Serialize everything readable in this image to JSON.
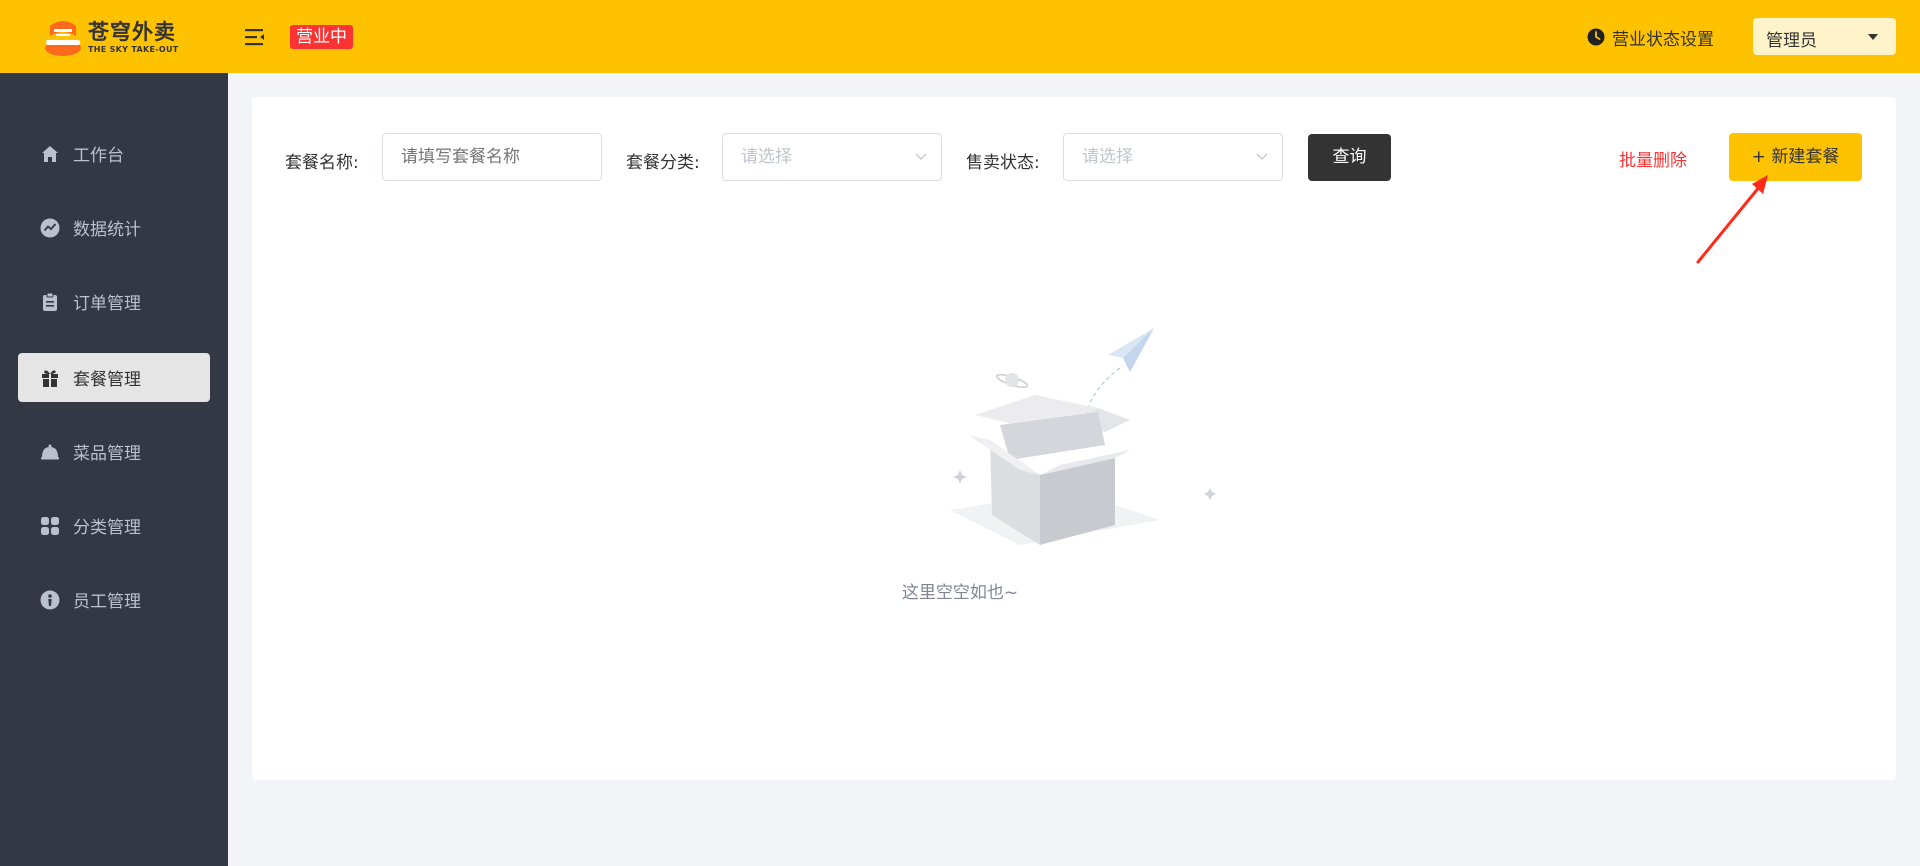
{
  "header": {
    "logo_cn": "苍穹外卖",
    "logo_en": "THE SKY TAKE-OUT",
    "status_tag": "营业中",
    "shop_setting": "营业状态设置",
    "user": "管理员"
  },
  "sidebar": {
    "items": [
      {
        "label": "工作台",
        "icon": "home-icon"
      },
      {
        "label": "数据统计",
        "icon": "chart-icon"
      },
      {
        "label": "订单管理",
        "icon": "clipboard-icon"
      },
      {
        "label": "套餐管理",
        "icon": "gift-icon",
        "active": true
      },
      {
        "label": "菜品管理",
        "icon": "dish-icon"
      },
      {
        "label": "分类管理",
        "icon": "grid-icon"
      },
      {
        "label": "员工管理",
        "icon": "employee-icon"
      }
    ]
  },
  "filters": {
    "name_label": "套餐名称:",
    "name_placeholder": "请填写套餐名称",
    "category_label": "套餐分类:",
    "category_placeholder": "请选择",
    "status_label": "售卖状态:",
    "status_placeholder": "请选择",
    "query_button": "查询"
  },
  "actions": {
    "batch_delete": "批量删除",
    "new_combo": "+ 新建套餐"
  },
  "empty": {
    "text": "这里空空如也~"
  },
  "colors": {
    "brand": "#ffc200",
    "sidebar": "#343744",
    "danger": "#fd3333"
  }
}
